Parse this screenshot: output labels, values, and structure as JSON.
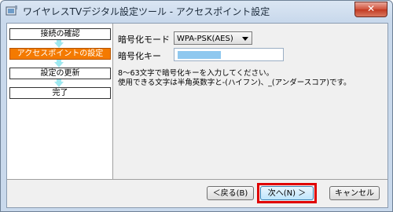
{
  "window": {
    "title": "ワイヤレスTVデジタル設定ツール - アクセスポイント設定",
    "close_label": "✕"
  },
  "steps": [
    {
      "label": "接続の確認",
      "active": false
    },
    {
      "label": "アクセスポイントの設定",
      "active": true
    },
    {
      "label": "設定の更新",
      "active": false
    },
    {
      "label": "完了",
      "active": false
    }
  ],
  "form": {
    "encryption_label": "暗号化モード",
    "encryption_value": "WPA-PSK(AES)",
    "key_label": "暗号化キー"
  },
  "note": {
    "line1": "8～63文字で暗号化キーを入力してください。",
    "line2": "使用できる文字は半角英数字と-(ハイフン)、_(アンダースコア)です。"
  },
  "buttons": {
    "back": "＜戻る(B)",
    "next": "次へ(N) ＞",
    "cancel": "キャンセル"
  },
  "colors": {
    "active_step": "#f47a00",
    "step_arrow": "#9fe8ef",
    "highlight": "#e00000"
  }
}
